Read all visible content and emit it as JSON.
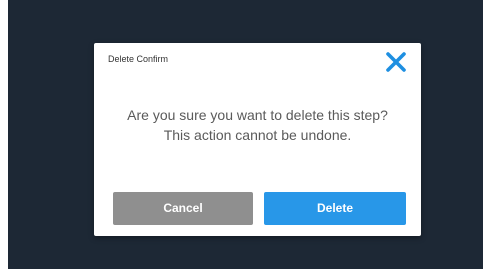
{
  "colors": {
    "backdrop": "#1d2835",
    "dialog_background": "#ffffff",
    "cancel_button": "#8f8f8f",
    "delete_button": "#2897e8",
    "close_icon": "#1e8fe1",
    "message_text": "#5a5a5a"
  },
  "dialog": {
    "title": "Delete Confirm",
    "close_icon": "close-icon",
    "message": "Are you sure you want to delete this step? This action cannot be undone.",
    "cancel_label": "Cancel",
    "delete_label": "Delete"
  }
}
